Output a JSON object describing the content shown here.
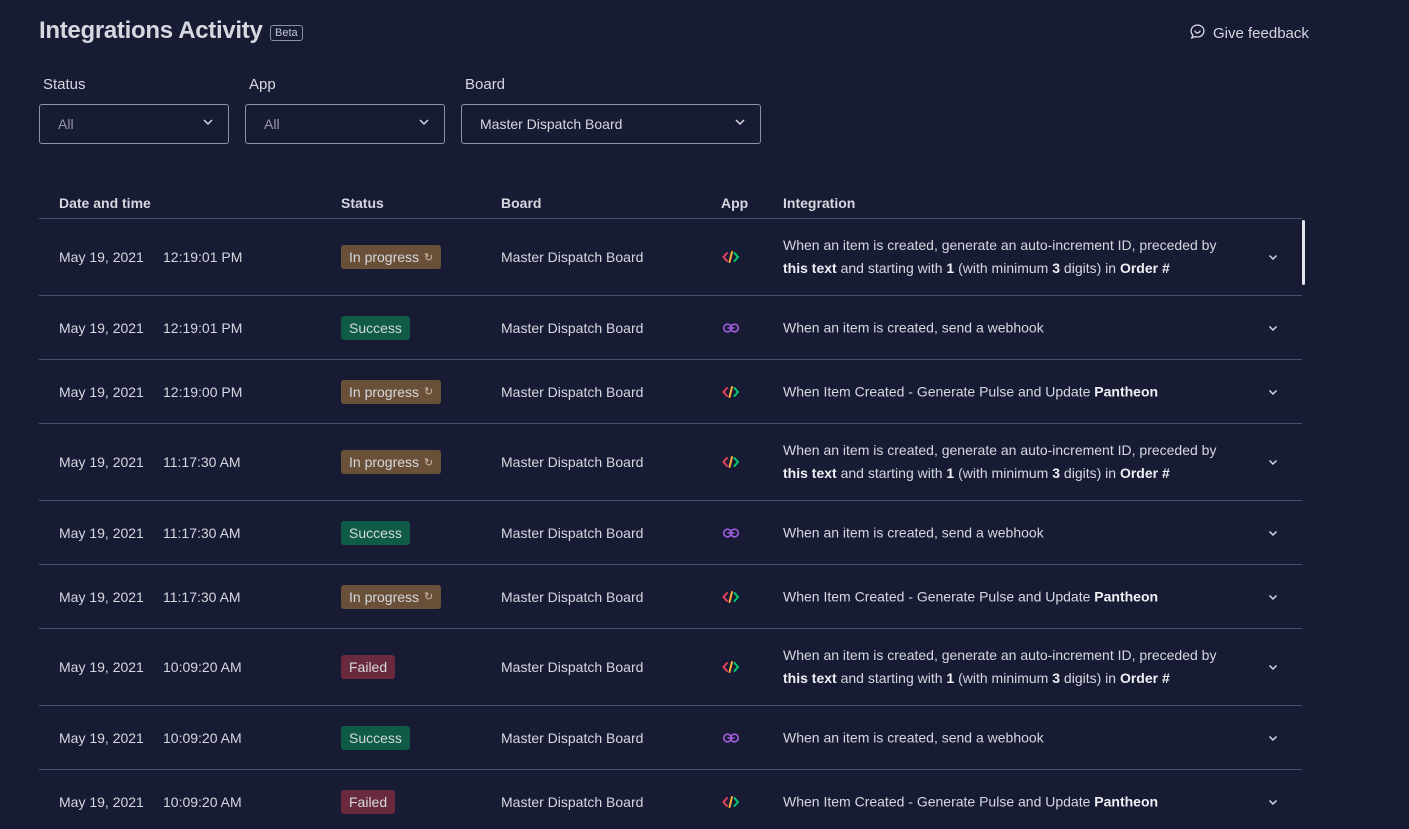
{
  "header": {
    "title": "Integrations Activity",
    "beta": "Beta",
    "feedback_label": "Give feedback"
  },
  "filters": {
    "status": {
      "label": "Status",
      "value": "All"
    },
    "app": {
      "label": "App",
      "value": "All"
    },
    "board": {
      "label": "Board",
      "value": "Master Dispatch Board"
    }
  },
  "table": {
    "columns": [
      "Date and time",
      "Status",
      "Board",
      "App",
      "Integration"
    ],
    "rows": [
      {
        "date": "May 19, 2021",
        "time": "12:19:01 PM",
        "status": "In progress",
        "status_type": "inprogress",
        "board": "Master Dispatch Board",
        "app": "code-icon",
        "integration": "When an item is created, generate an auto-increment ID, preceded by |this text| and starting with |1| (with minimum |3| digits) in |Order #|"
      },
      {
        "date": "May 19, 2021",
        "time": "12:19:01 PM",
        "status": "Success",
        "status_type": "success",
        "board": "Master Dispatch Board",
        "app": "webhook-icon",
        "integration": "When an item is created, send a webhook"
      },
      {
        "date": "May 19, 2021",
        "time": "12:19:00 PM",
        "status": "In progress",
        "status_type": "inprogress",
        "board": "Master Dispatch Board",
        "app": "code-icon",
        "integration": "When Item Created - Generate Pulse and Update |Pantheon|"
      },
      {
        "date": "May 19, 2021",
        "time": "11:17:30 AM",
        "status": "In progress",
        "status_type": "inprogress",
        "board": "Master Dispatch Board",
        "app": "code-icon",
        "integration": "When an item is created, generate an auto-increment ID, preceded by |this text| and starting with |1| (with minimum |3| digits) in |Order #|"
      },
      {
        "date": "May 19, 2021",
        "time": "11:17:30 AM",
        "status": "Success",
        "status_type": "success",
        "board": "Master Dispatch Board",
        "app": "webhook-icon",
        "integration": "When an item is created, send a webhook"
      },
      {
        "date": "May 19, 2021",
        "time": "11:17:30 AM",
        "status": "In progress",
        "status_type": "inprogress",
        "board": "Master Dispatch Board",
        "app": "code-icon",
        "integration": "When Item Created - Generate Pulse and Update |Pantheon|"
      },
      {
        "date": "May 19, 2021",
        "time": "10:09:20 AM",
        "status": "Failed",
        "status_type": "failed",
        "board": "Master Dispatch Board",
        "app": "code-icon",
        "integration": "When an item is created, generate an auto-increment ID, preceded by |this text| and starting with |1| (with minimum |3| digits) in |Order #|"
      },
      {
        "date": "May 19, 2021",
        "time": "10:09:20 AM",
        "status": "Success",
        "status_type": "success",
        "board": "Master Dispatch Board",
        "app": "webhook-icon",
        "integration": "When an item is created, send a webhook"
      },
      {
        "date": "May 19, 2021",
        "time": "10:09:20 AM",
        "status": "Failed",
        "status_type": "failed",
        "board": "Master Dispatch Board",
        "app": "code-icon",
        "integration": "When Item Created - Generate Pulse and Update |Pantheon|"
      }
    ]
  },
  "colors": {
    "background": "#181b34",
    "in_progress": "#6a5039",
    "success": "#0f5b47",
    "failed": "#6a2a3e"
  }
}
